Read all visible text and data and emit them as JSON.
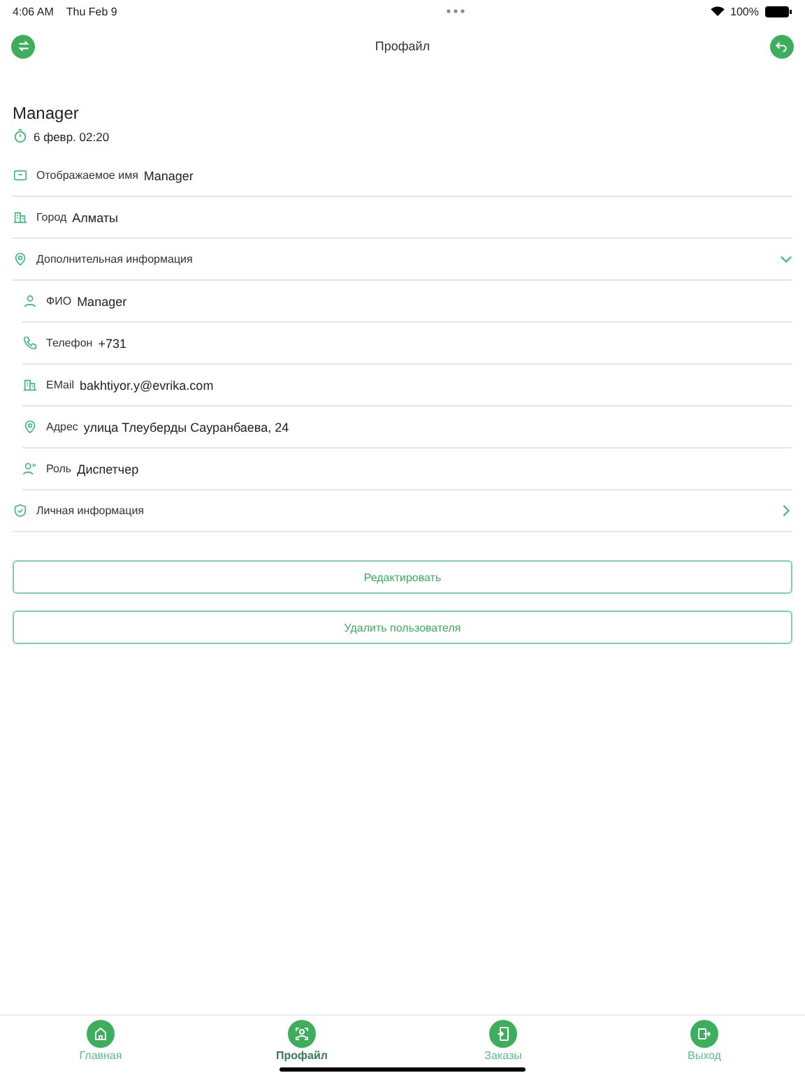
{
  "status_bar": {
    "time": "4:06 AM",
    "date": "Thu Feb 9",
    "battery": "100%"
  },
  "header": {
    "title": "Профайл"
  },
  "profile": {
    "name": "Manager",
    "timestamp": "6 февр. 02:20"
  },
  "rows": [
    {
      "kind": "field",
      "label": "Отображаемое имя",
      "value": "Manager"
    },
    {
      "kind": "field",
      "label": "Город",
      "value": "Алматы"
    },
    {
      "kind": "section",
      "label": "Дополнительная информация",
      "expanded": true,
      "children": [
        {
          "label": "ФИО",
          "value": "Manager"
        },
        {
          "label": "Телефон",
          "value": "+731"
        },
        {
          "label": "EMail",
          "value": "bakhtiyor.y@evrika.com"
        },
        {
          "label": "Адрес",
          "value": "улица Тлеуберды Сауранбаева, 24"
        },
        {
          "label": "Роль",
          "value": "Диспетчер"
        }
      ]
    },
    {
      "kind": "section",
      "label": "Личная информация",
      "expanded": false
    }
  ],
  "buttons": [
    "Редактировать",
    "Удалить пользователя"
  ],
  "tabs": [
    {
      "label": "Главная",
      "selected": false
    },
    {
      "label": "Профайл",
      "selected": true
    },
    {
      "label": "Заказы",
      "selected": false
    },
    {
      "label": "Выход",
      "selected": false
    }
  ]
}
